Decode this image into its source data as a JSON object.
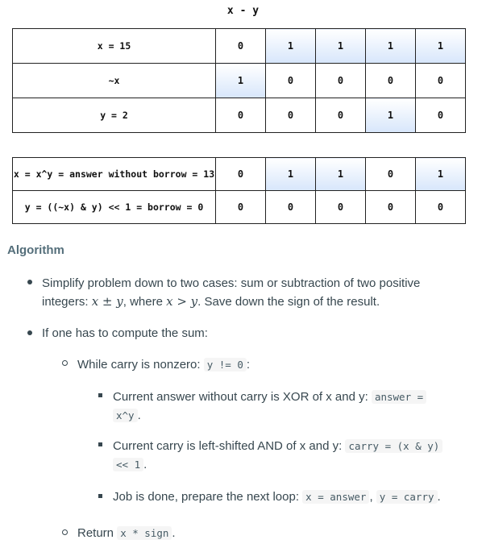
{
  "diagram": {
    "title": "x - y",
    "table1": [
      {
        "label": "x = 15",
        "bits": [
          "0",
          "1",
          "1",
          "1",
          "1"
        ],
        "highlight": [
          false,
          true,
          true,
          true,
          true
        ]
      },
      {
        "label": "~x",
        "bits": [
          "1",
          "0",
          "0",
          "0",
          "0"
        ],
        "highlight": [
          true,
          false,
          false,
          false,
          false
        ]
      },
      {
        "label": "y = 2",
        "bits": [
          "0",
          "0",
          "0",
          "1",
          "0"
        ],
        "highlight": [
          false,
          false,
          false,
          true,
          false
        ]
      }
    ],
    "table2": [
      {
        "label": "x = x^y = answer without borrow = 13",
        "bits": [
          "0",
          "1",
          "1",
          "0",
          "1"
        ],
        "highlight": [
          false,
          true,
          true,
          false,
          true
        ]
      },
      {
        "label": "y = ((~x) & y) << 1 = borrow = 0",
        "bits": [
          "0",
          "0",
          "0",
          "0",
          "0"
        ],
        "highlight": [
          false,
          false,
          false,
          false,
          false
        ]
      }
    ]
  },
  "algorithm": {
    "heading": "Algorithm",
    "b1_text_a": "Simplify problem down to two cases: sum or subtraction of two positive",
    "b1_text_b": "integers: ",
    "b1_math1": "x ± y",
    "b1_text_c": ", where ",
    "b1_math2": "x > y",
    "b1_text_d": ". Save down the sign of the result.",
    "b2_text": "If one has to compute the sum:",
    "b3_text": "While carry is nonzero: ",
    "b3_code": "y != 0",
    "b3_end": ":",
    "b4_text": "Current answer without carry is XOR of x and y: ",
    "b4_code1": "answer =",
    "b4_code2": "x^y",
    "b4_end": ".",
    "b5_text": "Current carry is left-shifted AND of x and y: ",
    "b5_code1": "carry = (x & y)",
    "b5_code2": "<< 1",
    "b5_end": ".",
    "b6_text": "Job is done, prepare the next loop: ",
    "b6_code1": "x = answer",
    "b6_sep": ", ",
    "b6_code2": "y = carry",
    "b6_end": ".",
    "b7_text": "Return ",
    "b7_code": "x * sign",
    "b7_end": "."
  }
}
